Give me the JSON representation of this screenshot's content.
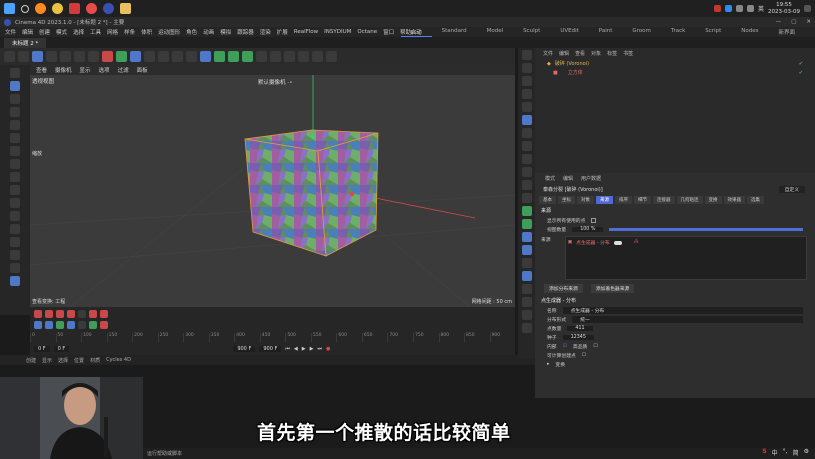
{
  "taskbar": {
    "lang": "英",
    "time": "19:55",
    "date": "2023-03-09"
  },
  "titlebar": {
    "title": "Cinema 4D 2023.1.0 - [未标题 2 *] - 主要"
  },
  "menu": {
    "items": [
      "文件",
      "编辑",
      "创建",
      "模式",
      "选择",
      "工具",
      "网格",
      "样条",
      "体积",
      "运动图形",
      "角色",
      "动画",
      "模拟",
      "跟踪器",
      "渲染",
      "扩展",
      "RealFlow",
      "INSYDIUM",
      "Octane",
      "窗口",
      "帮助"
    ]
  },
  "doc_tab": "未标题 2 *",
  "layouts": [
    "启动",
    "Standard",
    "Model",
    "Sculpt",
    "UVEdit",
    "Paint",
    "Groom",
    "Track",
    "Script",
    "Nodes",
    "新界面"
  ],
  "viewport": {
    "menu": [
      "查看",
      "摄像机",
      "显示",
      "选项",
      "过滤",
      "面板"
    ],
    "label": "透视视图",
    "camera": "默认摄像机 ·∘",
    "scale_label": "缩放",
    "bottom_left": "查看变换: 工程",
    "bottom_right": "网格间距 : 50 cm"
  },
  "timeline": {
    "ticks": [
      "0",
      "50",
      "100",
      "150",
      "200",
      "250",
      "300",
      "350",
      "400",
      "450",
      "500",
      "550",
      "600",
      "650",
      "700",
      "750",
      "800",
      "850",
      "900"
    ],
    "start": "0 F",
    "current": "0 F",
    "end": "900 F",
    "end2": "900 F"
  },
  "statusbar": [
    "创建",
    "显示",
    "选择",
    "位置",
    "材质",
    "Cycles 4D"
  ],
  "objects": {
    "menu": [
      "文件",
      "编辑",
      "查看",
      "对象",
      "标签",
      "书签"
    ],
    "items": [
      {
        "name": "破碎 (Voronoi)"
      },
      {
        "name": "立方体"
      }
    ]
  },
  "attributes": {
    "menu": [
      "模式",
      "编辑",
      "用户数据"
    ],
    "title": "泰森分裂 [破碎 (Voronoi)]",
    "dropdown": "自定义",
    "tabs": [
      "基本",
      "坐标",
      "对象",
      "来源",
      "排序",
      "细节",
      "连接器",
      "几何粘连",
      "变换",
      "效果器",
      "选集"
    ],
    "active_tab": "来源",
    "section_source": "来源",
    "rows": [
      {
        "label": "显示所有使用的点"
      },
      {
        "label": "视图数量",
        "value": "100 %"
      }
    ],
    "source_label": "来源",
    "source_item": "点生成器 - 分布",
    "buttons": [
      "添加分布来源",
      "添加着色器来源"
    ],
    "section_gen": "点生成器 - 分布",
    "name_label": "名称",
    "name_value": "点生成器 - 分布",
    "dist_label": "分布形式",
    "dist_value": "统一",
    "count_label": "点数量",
    "count_value": "411",
    "seed_label": "种子",
    "seed_value": "12345",
    "inner_label": "内部",
    "highres_label": "高品质",
    "vis_label": "可计算创建点",
    "transform_label": "变换"
  },
  "subtitle": "首先第一个推散的话比较简单",
  "bottom_status": "运行帮助或脚本",
  "ime": [
    "中",
    "°,",
    "简",
    "⚙"
  ]
}
